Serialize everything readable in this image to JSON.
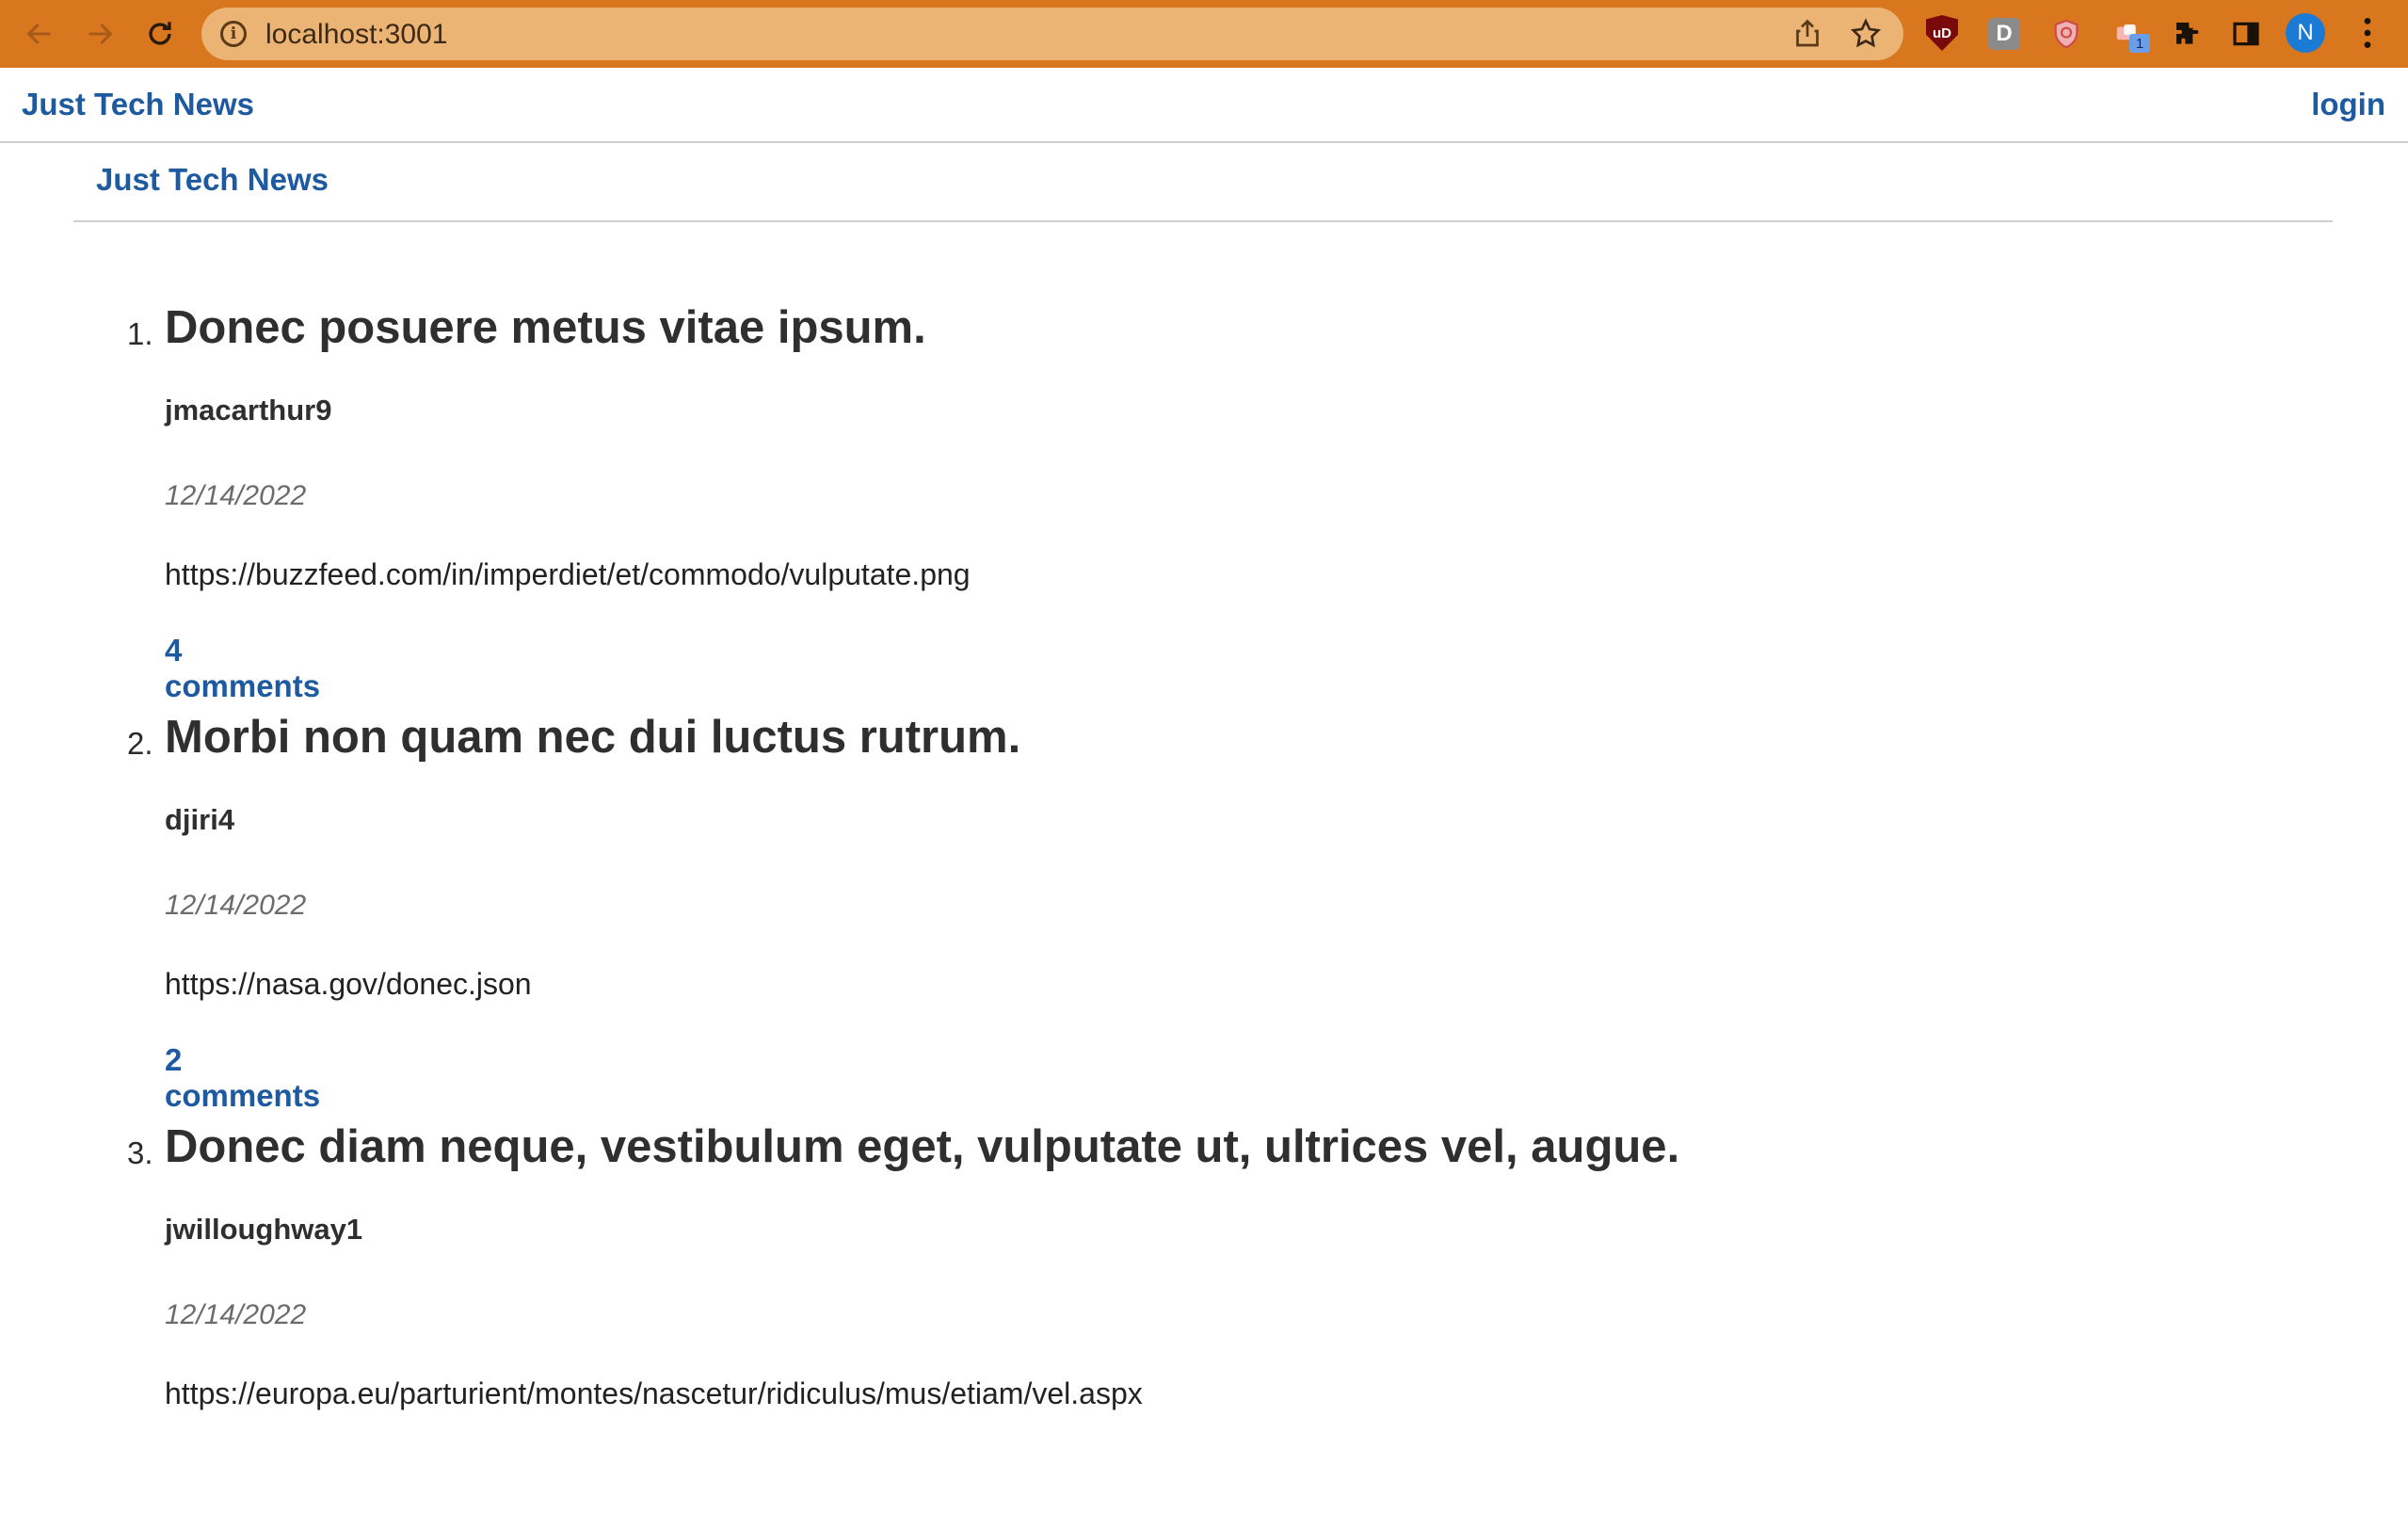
{
  "browser": {
    "url": "localhost:3001",
    "profile_initial": "N",
    "extensions": [
      {
        "icon": "ublock-icon",
        "label": "uD"
      },
      {
        "icon": "d-extension-icon",
        "label": "D"
      },
      {
        "icon": "shield-extension-icon"
      },
      {
        "icon": "badge-extension-icon",
        "badge": "1"
      },
      {
        "icon": "puzzle-icon"
      },
      {
        "icon": "side-panel-icon"
      }
    ],
    "colors": {
      "toolbar": "#d9771f",
      "omnibox": "#ebb475",
      "avatar": "#1a7ad4"
    }
  },
  "header": {
    "brand": "Just Tech News",
    "login_label": "login"
  },
  "subheader": {
    "brand": "Just Tech News"
  },
  "posts": [
    {
      "number": "1.",
      "title": "Donec posuere metus vitae ipsum.",
      "author": "jmacarthur9",
      "date": "12/14/2022",
      "url": "https://buzzfeed.com/in/imperdiet/et/commodo/vulputate.png",
      "comments": "4 comments"
    },
    {
      "number": "2.",
      "title": "Morbi non quam nec dui luctus rutrum.",
      "author": "djiri4",
      "date": "12/14/2022",
      "url": "https://nasa.gov/donec.json",
      "comments": "2 comments"
    },
    {
      "number": "3.",
      "title": "Donec diam neque, vestibulum eget, vulputate ut, ultrices vel, augue.",
      "author": "jwilloughway1",
      "date": "12/14/2022",
      "url": "https://europa.eu/parturient/montes/nascetur/ridiculus/mus/etiam/vel.aspx",
      "comments": ""
    }
  ],
  "colors": {
    "link": "#1e5aa0",
    "text": "#2f2f2f",
    "date": "#6b6b6b"
  }
}
